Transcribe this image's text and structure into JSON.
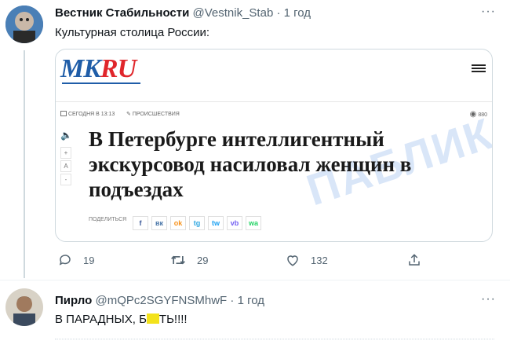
{
  "tweet1": {
    "name": "Вестник Стабильности",
    "handle": "@Vestnik_Stab",
    "dot": "·",
    "time": "1 год",
    "more": "···",
    "text": "Культурная столица России:",
    "card": {
      "logo_mk": "MK",
      "logo_ru": "RU",
      "date_label": "СЕГОДНЯ В 13:13",
      "category": "ПРОИСШЕСТВИЯ",
      "views": "880",
      "headline": "В Петербурге интеллигентный экскурсовод насиловал женщин в подъездах",
      "watermark": "ПАБЛИК",
      "tool_plus": "+",
      "tool_a": "A",
      "tool_minus": "-",
      "share_label": "ПОДЕЛИТЬСЯ",
      "share_icons": [
        "f",
        "вк",
        "ok",
        "tg",
        "tw",
        "vb",
        "wa"
      ]
    },
    "actions": {
      "replies": "19",
      "retweets": "29",
      "likes": "132"
    }
  },
  "tweet2": {
    "name": "Пирло",
    "handle": "@mQPc2SGYFNSMhwF",
    "dot": "·",
    "time": "1 год",
    "more": "···",
    "text": "В ПАРАДНЫХ, Б",
    "text_censor_end": "ТЬ!!!!"
  },
  "colors": {
    "mk_blue": "#1f5da8",
    "mk_red": "#e0262b",
    "secondary_text": "#536471",
    "censor_yellow": "#f3e21b"
  }
}
